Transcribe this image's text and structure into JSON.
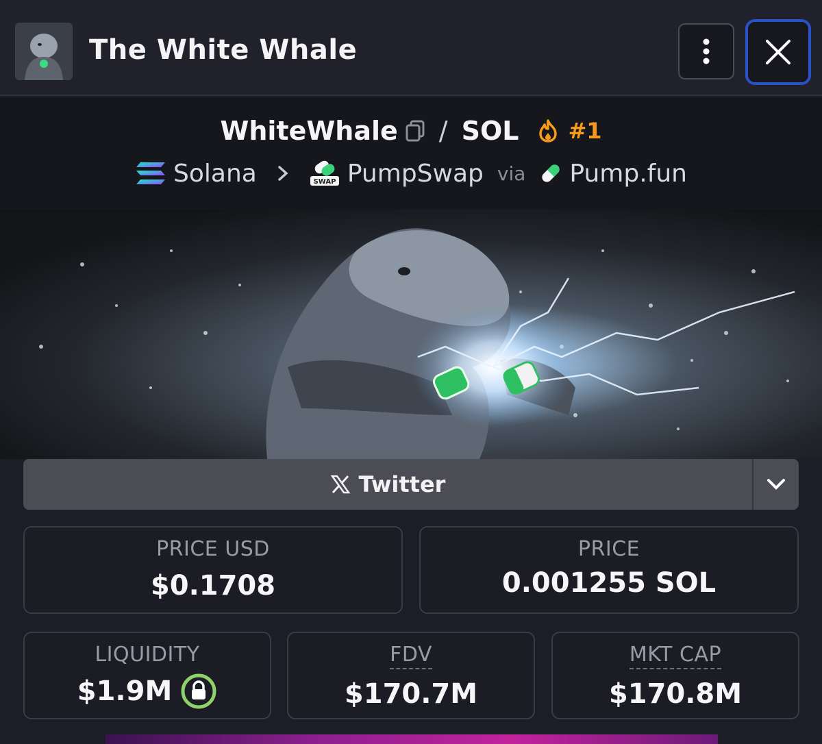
{
  "header": {
    "title": "The White Whale",
    "avatar_icon": "whale-avatar",
    "menu_icon": "vertical-dots-icon",
    "close_icon": "close-icon",
    "close_border_color": "#2b51c8"
  },
  "pair": {
    "base": "WhiteWhale",
    "separator": "/",
    "quote": "SOL",
    "rank": "#1",
    "rank_color": "#f59a1a",
    "copy_icon": "copy-icon",
    "flame_icon": "flame-icon"
  },
  "route": {
    "chain": "Solana",
    "dex": "PumpSwap",
    "dex_badge": "SWAP",
    "via": "via",
    "launchpad": "Pump.fun"
  },
  "social": {
    "label": "Twitter",
    "icon": "x-logo-icon",
    "dropdown_icon": "chevron-down-icon"
  },
  "stats": {
    "price_usd": {
      "label": "PRICE USD",
      "value": "$0.1708"
    },
    "price": {
      "label": "PRICE",
      "value": "0.001255 SOL"
    },
    "liquidity": {
      "label": "LIQUIDITY",
      "value": "$1.9M",
      "icon": "lock-icon",
      "lock_color": "#8fd16a"
    },
    "fdv": {
      "label": "FDV",
      "value": "$170.7M"
    },
    "mkt_cap": {
      "label": "MKT CAP",
      "value": "$170.8M"
    }
  }
}
